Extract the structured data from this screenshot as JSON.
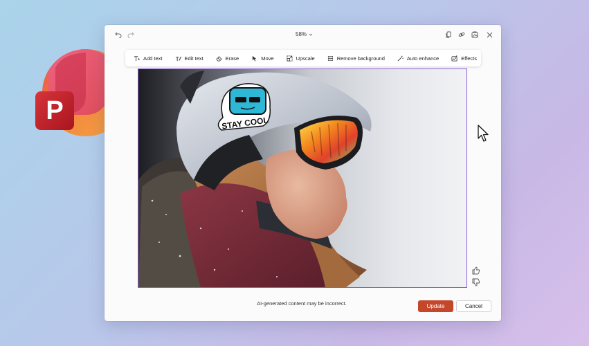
{
  "app": {
    "logo_letter": "P",
    "brand_colors": {
      "red": "#c4262e",
      "orange": "#f7943a",
      "pink": "#e7466d"
    }
  },
  "titlebar": {
    "zoom_label": "58%",
    "icons": [
      "undo-icon",
      "redo-icon",
      "copy-icon",
      "link-icon",
      "save-image-icon",
      "close-icon"
    ]
  },
  "toolbar": {
    "items": [
      {
        "label": "Add text",
        "icon": "add-text-icon"
      },
      {
        "label": "Edit text",
        "icon": "edit-text-icon"
      },
      {
        "label": "Erase",
        "icon": "eraser-icon"
      },
      {
        "label": "Move",
        "icon": "move-icon"
      },
      {
        "label": "Upscale",
        "icon": "upscale-icon"
      },
      {
        "label": "Remove background",
        "icon": "remove-background-icon"
      },
      {
        "label": "Auto enhance",
        "icon": "auto-enhance-icon"
      },
      {
        "label": "Effects",
        "icon": "effects-icon"
      }
    ]
  },
  "image": {
    "sticker_text": "STAY COOL",
    "accent_color": "#8a5cd6"
  },
  "footer": {
    "disclaimer": "AI-generated content may be incorrect.",
    "update_label": "Update",
    "cancel_label": "Cancel",
    "update_color": "#c4472b"
  }
}
